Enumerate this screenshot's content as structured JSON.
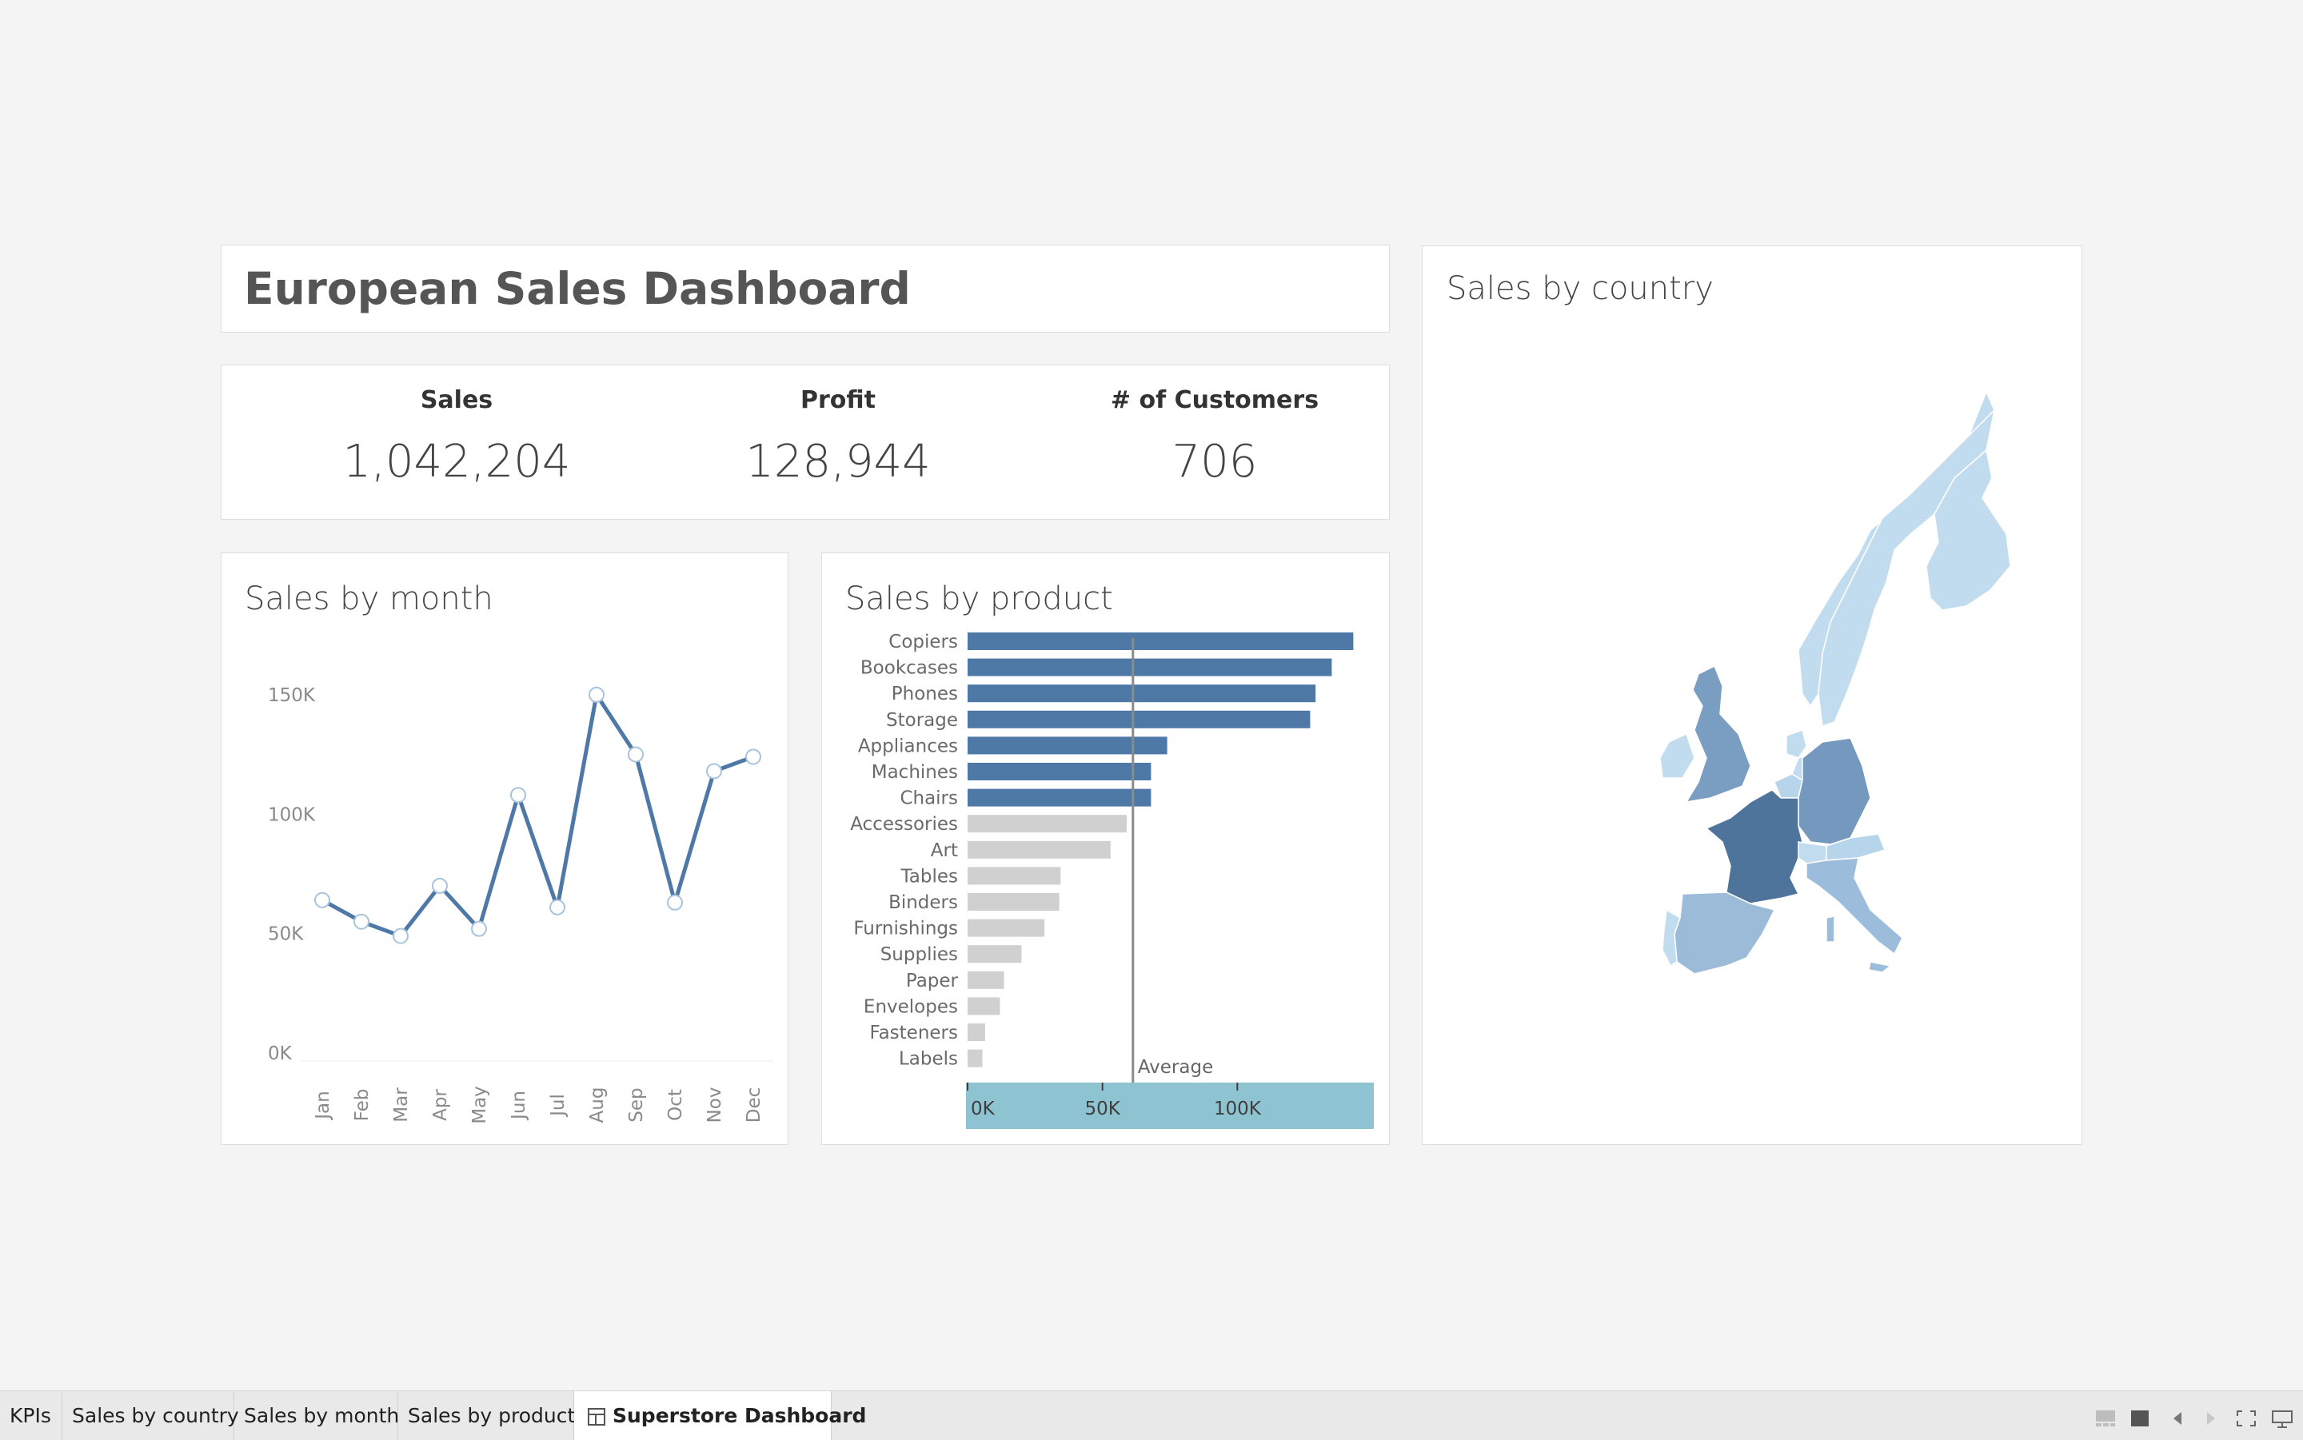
{
  "dashboard": {
    "title": "European Sales Dashboard"
  },
  "kpis": [
    {
      "label": "Sales",
      "value": "1,042,204"
    },
    {
      "label": "Profit",
      "value": "128,944"
    },
    {
      "label": "# of Customers",
      "value": "706"
    }
  ],
  "panels": {
    "month_title": "Sales by month",
    "product_title": "Sales by product",
    "country_title": "Sales by country"
  },
  "chart_data": [
    {
      "type": "line",
      "title": "Sales by month",
      "x": [
        "Jan",
        "Feb",
        "Mar",
        "Apr",
        "May",
        "Jun",
        "Jul",
        "Aug",
        "Sep",
        "Oct",
        "Nov",
        "Dec"
      ],
      "values": [
        64000,
        55000,
        49000,
        70000,
        52000,
        108000,
        61000,
        150000,
        125000,
        63000,
        118000,
        124000
      ],
      "yticks": [
        "150K",
        "100K",
        "50K",
        "0K"
      ],
      "ylim": [
        0,
        160000
      ],
      "color": "#4e79a7",
      "marker_fill": "#ffffff",
      "marker_stroke": "#a8c3dd"
    },
    {
      "type": "bar",
      "orientation": "horizontal",
      "title": "Sales by product",
      "categories": [
        "Copiers",
        "Bookcases",
        "Phones",
        "Storage",
        "Appliances",
        "Machines",
        "Chairs",
        "Accessories",
        "Art",
        "Tables",
        "Binders",
        "Furnishings",
        "Supplies",
        "Paper",
        "Envelopes",
        "Fasteners",
        "Labels"
      ],
      "values": [
        143000,
        135000,
        129000,
        127000,
        74000,
        68000,
        68000,
        59000,
        53000,
        34500,
        34000,
        28500,
        20000,
        13500,
        12000,
        6500,
        5500
      ],
      "xticks": [
        "0K",
        "50K",
        "100K"
      ],
      "xlim": [
        0,
        150000
      ],
      "reference_line": {
        "label": "Average",
        "value": 61300
      },
      "above_average_color": "#4e79a7",
      "below_average_color": "#d0d0d0",
      "axis_highlight_color": "#8ec3d2"
    }
  ],
  "map": {
    "title": "Sales by country",
    "countries": [
      {
        "name": "France",
        "shade": "#4f749b"
      },
      {
        "name": "Germany",
        "shade": "#7498be"
      },
      {
        "name": "United Kingdom",
        "shade": "#7a9dc2"
      },
      {
        "name": "Spain",
        "shade": "#9bbbd9"
      },
      {
        "name": "Italy",
        "shade": "#9cbcdb"
      },
      {
        "name": "Sweden",
        "shade": "#c0dcee"
      },
      {
        "name": "Norway",
        "shade": "#c0dcee"
      },
      {
        "name": "Finland",
        "shade": "#c0dcee"
      },
      {
        "name": "Ireland",
        "shade": "#c0dcee"
      },
      {
        "name": "Portugal",
        "shade": "#c0dcee"
      },
      {
        "name": "Austria",
        "shade": "#b7d5ea"
      },
      {
        "name": "Switzerland",
        "shade": "#c0dcee"
      },
      {
        "name": "Netherlands",
        "shade": "#c0dcee"
      },
      {
        "name": "Belgium",
        "shade": "#b7d5ea"
      },
      {
        "name": "Denmark",
        "shade": "#c0dcee"
      }
    ]
  },
  "tabs": [
    {
      "label": "KPIs",
      "active": false
    },
    {
      "label": "Sales by country",
      "active": false
    },
    {
      "label": "Sales by month",
      "active": false
    },
    {
      "label": "Sales by product",
      "active": false
    },
    {
      "label": "Superstore Dashboard",
      "active": true
    }
  ],
  "toolbar_icons": [
    "storyboard-icon",
    "dashboard-icon",
    "previous-icon",
    "next-icon",
    "fullscreen-icon",
    "presentation-icon"
  ]
}
